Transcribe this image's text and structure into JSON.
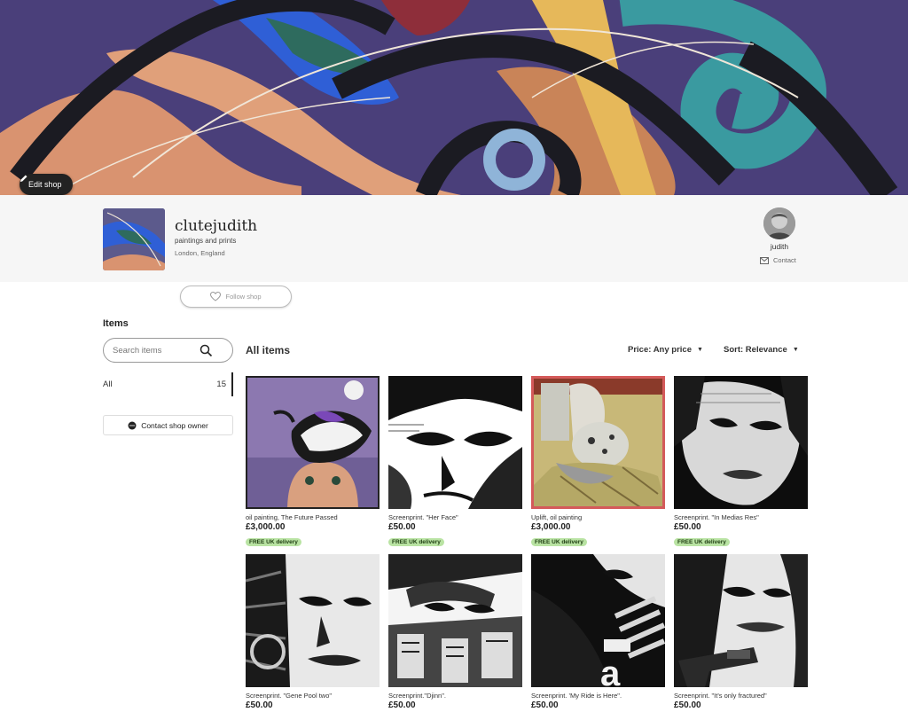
{
  "banner": {
    "edit_label": "Edit shop"
  },
  "shop": {
    "name": "clutejudith",
    "tagline": "paintings and prints",
    "location": "London, England",
    "follow_label": "Follow shop"
  },
  "owner": {
    "name": "judith",
    "contact_label": "Contact"
  },
  "sidebar": {
    "heading": "Items",
    "search_placeholder": "Search items",
    "categories": [
      {
        "label": "All",
        "count": "15"
      }
    ],
    "contact_owner_label": "Contact shop owner"
  },
  "main": {
    "heading": "All items",
    "price_filter": "Price: Any price",
    "sort_filter": "Sort: Relevance",
    "listings": [
      {
        "title": "oil painting, The Future Passed",
        "price": "£3,000.00",
        "badge": "FREE UK delivery"
      },
      {
        "title": "Screenprint. \"Her Face\"",
        "price": "£50.00",
        "badge": "FREE UK delivery"
      },
      {
        "title": "Uplift, oil painting",
        "price": "£3,000.00",
        "badge": "FREE UK delivery"
      },
      {
        "title": "Screenprint. \"In Medias Res\"",
        "price": "£50.00",
        "badge": "FREE UK delivery"
      },
      {
        "title": "Screenprint. \"Gene Pool two\"",
        "price": "£50.00"
      },
      {
        "title": "Screenprint.\"Djinn\".",
        "price": "£50.00"
      },
      {
        "title": "Screenprint. 'My Ride is Here\".",
        "price": "£50.00"
      },
      {
        "title": "Screenprint. \"It's only fractured\"",
        "price": "£50.00"
      }
    ]
  },
  "colors": {
    "banner_bg": "#4a3f7a",
    "band_bg": "#f6f6f6",
    "badge_bg": "#b9e3a3",
    "text_primary": "#222222"
  }
}
